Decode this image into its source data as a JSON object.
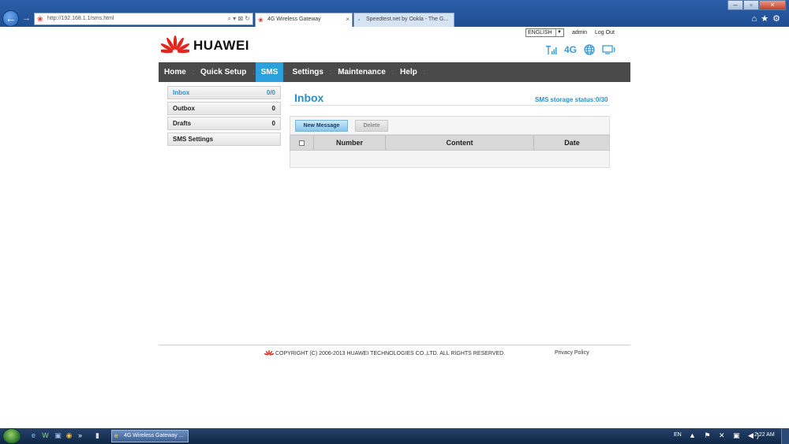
{
  "browser": {
    "address_url": "http://192.168.1.1/sms.html",
    "address_tools": "⌕ ▾ ⊠ ↻",
    "tabs": [
      {
        "label": "4G Wireless Gateway",
        "active": true
      },
      {
        "label": "Speedtest.net by Ookla - The G...",
        "active": false
      }
    ],
    "tab_close": "×",
    "window_controls": [
      "–",
      "▫",
      "×"
    ],
    "toolbar_icons": "⌂★⚙"
  },
  "header": {
    "language": "ENGLISH",
    "user": "admin",
    "logout": "Log Out",
    "brand": "HUAWEI",
    "network_type": "4G"
  },
  "menu": {
    "items": [
      {
        "label": "Home",
        "active": false
      },
      {
        "label": "Quick Setup",
        "active": false
      },
      {
        "label": "SMS",
        "active": true
      },
      {
        "label": "Settings",
        "active": false
      },
      {
        "label": "Maintenance",
        "active": false
      },
      {
        "label": "Help",
        "active": false
      }
    ],
    "separator": ":"
  },
  "sidebar": {
    "items": [
      {
        "label": "Inbox",
        "count": "0/0",
        "active": true
      },
      {
        "label": "Outbox",
        "count": "0",
        "active": false
      },
      {
        "label": "Drafts",
        "count": "0",
        "active": false
      },
      {
        "label": "SMS Settings",
        "count": "",
        "active": false
      }
    ]
  },
  "content": {
    "title": "Inbox",
    "storage_status": "SMS storage status:0/30",
    "new_message": "New Message",
    "delete": "Delete",
    "columns": {
      "number": "Number",
      "content": "Content",
      "date": "Date"
    }
  },
  "footer": {
    "copyright": "COPYRIGHT (C) 2006-2013 HUAWEI TECHNOLOGIES CO.,LTD. ALL RIGHTS RESERVED.",
    "privacy": "Privacy Policy"
  },
  "taskbar": {
    "quick_launch": [
      "e",
      "W",
      "◉",
      "»",
      "▮"
    ],
    "task_label": "4G Wireless Gateway ...",
    "lang": "EN",
    "tray": "▲ ⚑ ✕ ▣ ◀)",
    "clock": "2:22 AM"
  },
  "colors": {
    "accent": "#2aa0dc",
    "menu_bg": "#4a4a4a",
    "brand_red": "#e1261c"
  }
}
